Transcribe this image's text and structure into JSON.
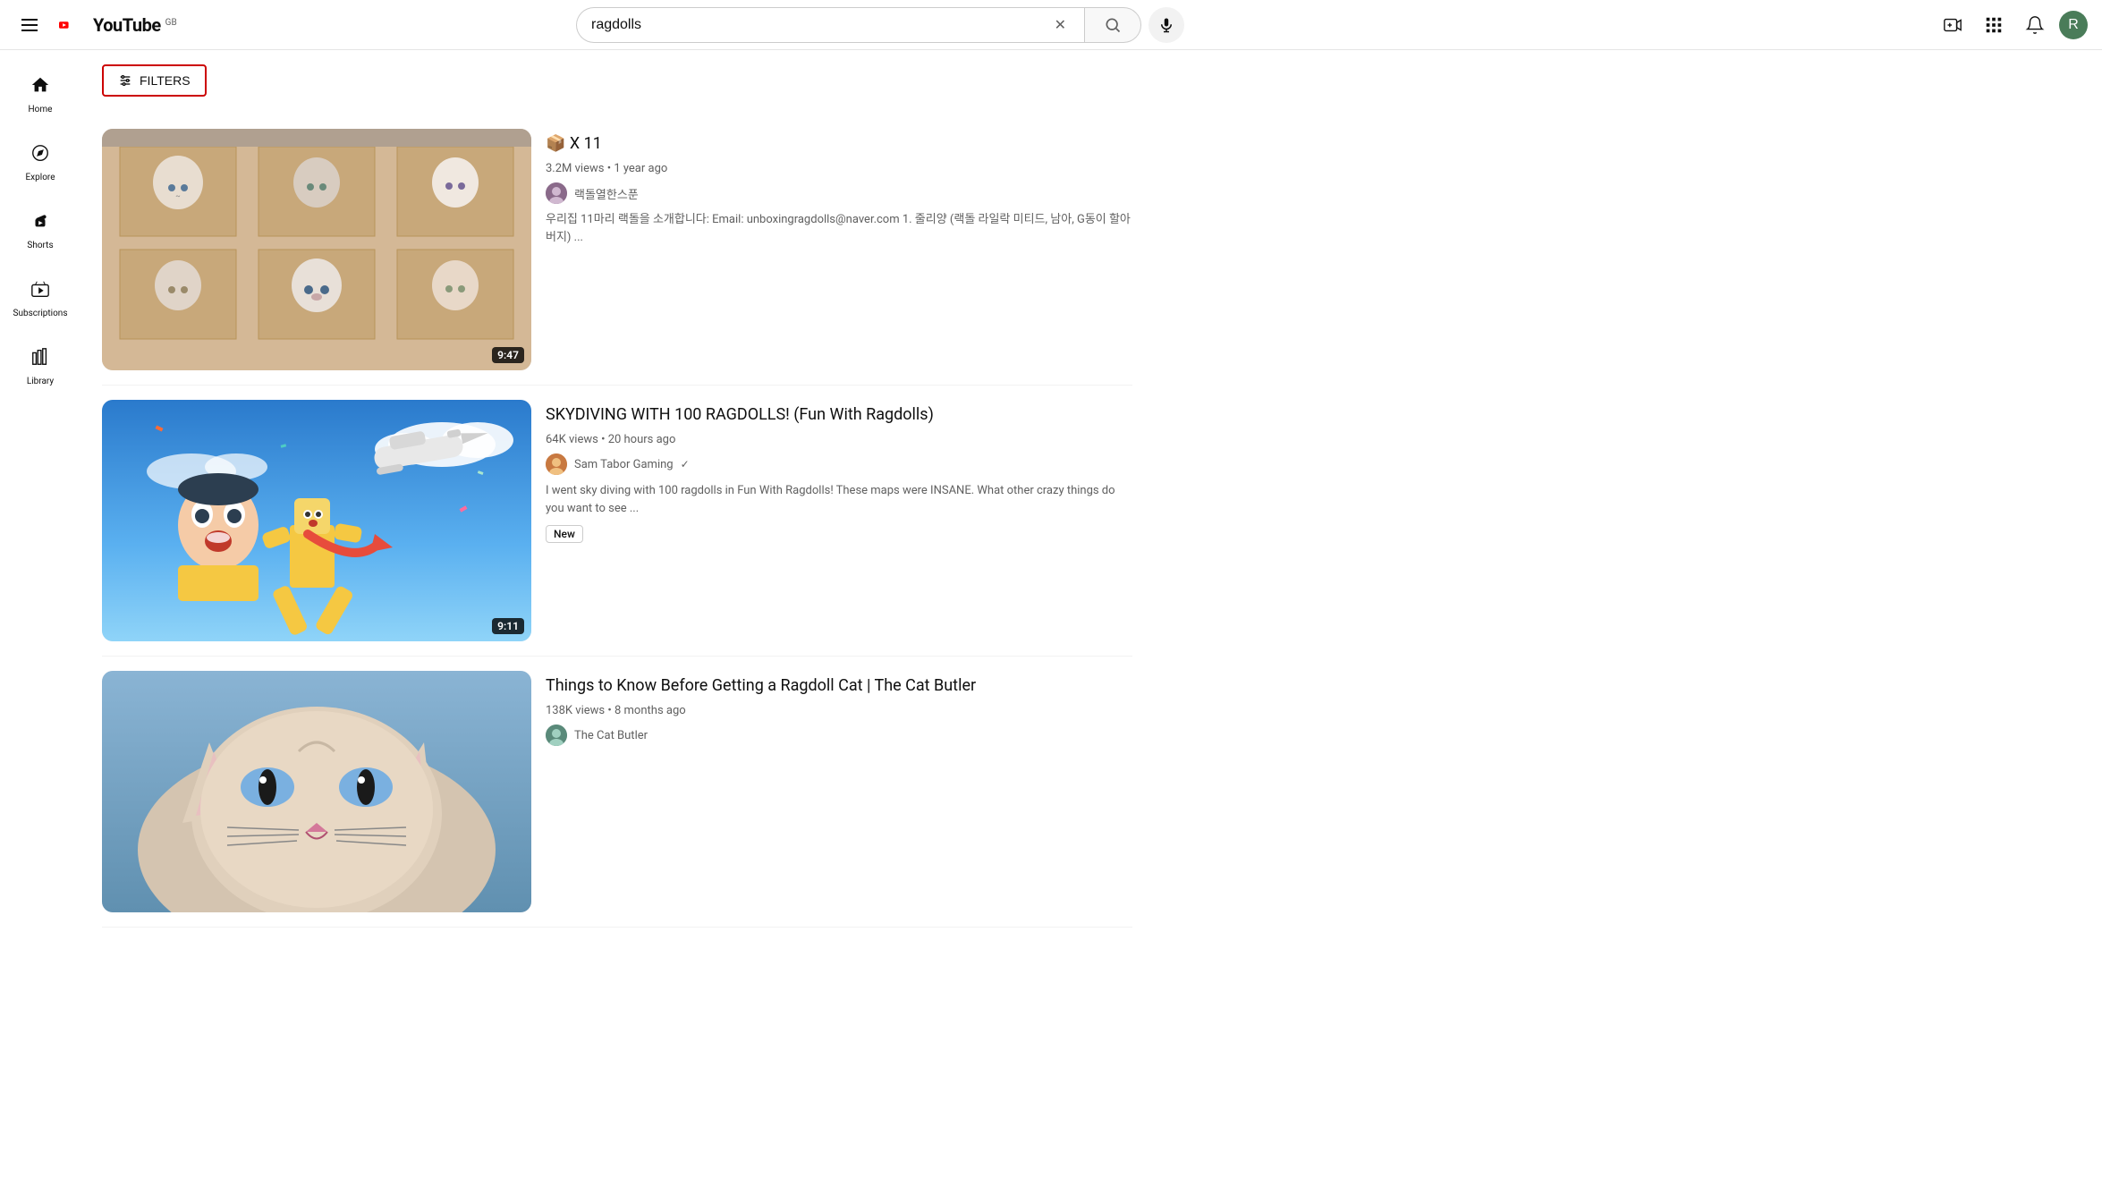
{
  "header": {
    "hamburger_label": "menu",
    "logo_text": "YouTube",
    "logo_country": "GB",
    "search_value": "ragdolls",
    "search_placeholder": "Search",
    "voice_search_label": "Search by voice",
    "create_label": "Create",
    "apps_label": "YouTube apps",
    "notifications_label": "Notifications",
    "avatar_initial": "R"
  },
  "sidebar": {
    "items": [
      {
        "id": "home",
        "label": "Home",
        "icon": "home"
      },
      {
        "id": "explore",
        "label": "Explore",
        "icon": "explore"
      },
      {
        "id": "shorts",
        "label": "Shorts",
        "icon": "shorts"
      },
      {
        "id": "subscriptions",
        "label": "Subscriptions",
        "icon": "subscriptions"
      },
      {
        "id": "library",
        "label": "Library",
        "icon": "library"
      }
    ]
  },
  "filters": {
    "button_label": "FILTERS"
  },
  "results": [
    {
      "id": "video1",
      "title": "📦 X 11",
      "views": "3.2M views",
      "age": "1 year ago",
      "channel_name": "랙돌열한스푼",
      "channel_verified": false,
      "channel_color": "#8a6a8a",
      "description": "우리집 11마리 랙돌을 소개합니다: Email: unboxingragdolls@naver.com 1. 줄리양 (랙돌 라일락 미티드, 남아, G동이 할아버지) ...",
      "duration": "9:47",
      "thumbnail_type": "cats_grid"
    },
    {
      "id": "video2",
      "title": "SKYDIVING WITH 100 RAGDOLLS! (Fun With Ragdolls)",
      "views": "64K views",
      "age": "20 hours ago",
      "channel_name": "Sam Tabor Gaming",
      "channel_verified": true,
      "channel_color": "#c87941",
      "description": "I went sky diving with 100 ragdolls in Fun With Ragdolls! These maps were INSANE. What other crazy things do you want to see ...",
      "duration": "9:11",
      "thumbnail_type": "skydiving",
      "badge": "New"
    },
    {
      "id": "video3",
      "title": "Things to Know Before Getting a Ragdoll Cat | The Cat Butler",
      "views": "138K views",
      "age": "8 months ago",
      "channel_name": "The Cat Butler",
      "channel_verified": false,
      "channel_color": "#5a8a7a",
      "description": "",
      "duration": "",
      "thumbnail_type": "cat_close"
    }
  ]
}
